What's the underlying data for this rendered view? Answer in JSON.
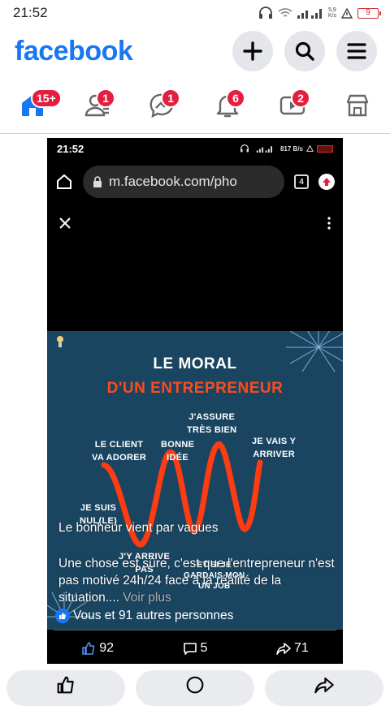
{
  "status_bar": {
    "time": "21:52",
    "network_speed_top": "5,9",
    "network_speed_unit": "K/s",
    "battery": "9"
  },
  "header": {
    "logo": "facebook"
  },
  "nav": {
    "items": [
      {
        "name": "home",
        "badge": "15+"
      },
      {
        "name": "friends",
        "badge": "1"
      },
      {
        "name": "messenger",
        "badge": "1"
      },
      {
        "name": "notifications",
        "badge": "6"
      },
      {
        "name": "watch",
        "badge": "2"
      },
      {
        "name": "marketplace",
        "badge": ""
      }
    ]
  },
  "post_media": {
    "inner_status": {
      "time": "21:52",
      "speed": "817 B/s"
    },
    "browser": {
      "url": "m.facebook.com/pho",
      "tab_count": "4"
    },
    "poster": {
      "title_line1": "LE MORAL",
      "title_line2": "D'UN ENTREPRENEUR",
      "labels": {
        "assure": "J'ASSURE\nTRÈS BIEN",
        "client": "LE CLIENT\nVA ADORER",
        "bonne": "BONNE\nIDÉE",
        "vais": "JE VAIS Y\nARRIVER",
        "suis": "JE SUIS\nNUL(LE)",
        "narrive": "J'Y ARRIVE\nPAS",
        "job": "ET SI JE\nGARDAIS MON\nUN JOB"
      }
    },
    "caption": {
      "line1": "Le bonheur vient par vagues",
      "body": "Une chose est sûre, c'est que l'entrepreneur n'est pas motivé 24h/24 face à la réalité de la situation....",
      "more": "Voir plus"
    },
    "reactions": "Vous et 91 autres personnes",
    "counts": {
      "likes": "92",
      "comments": "5",
      "shares": "71"
    }
  }
}
